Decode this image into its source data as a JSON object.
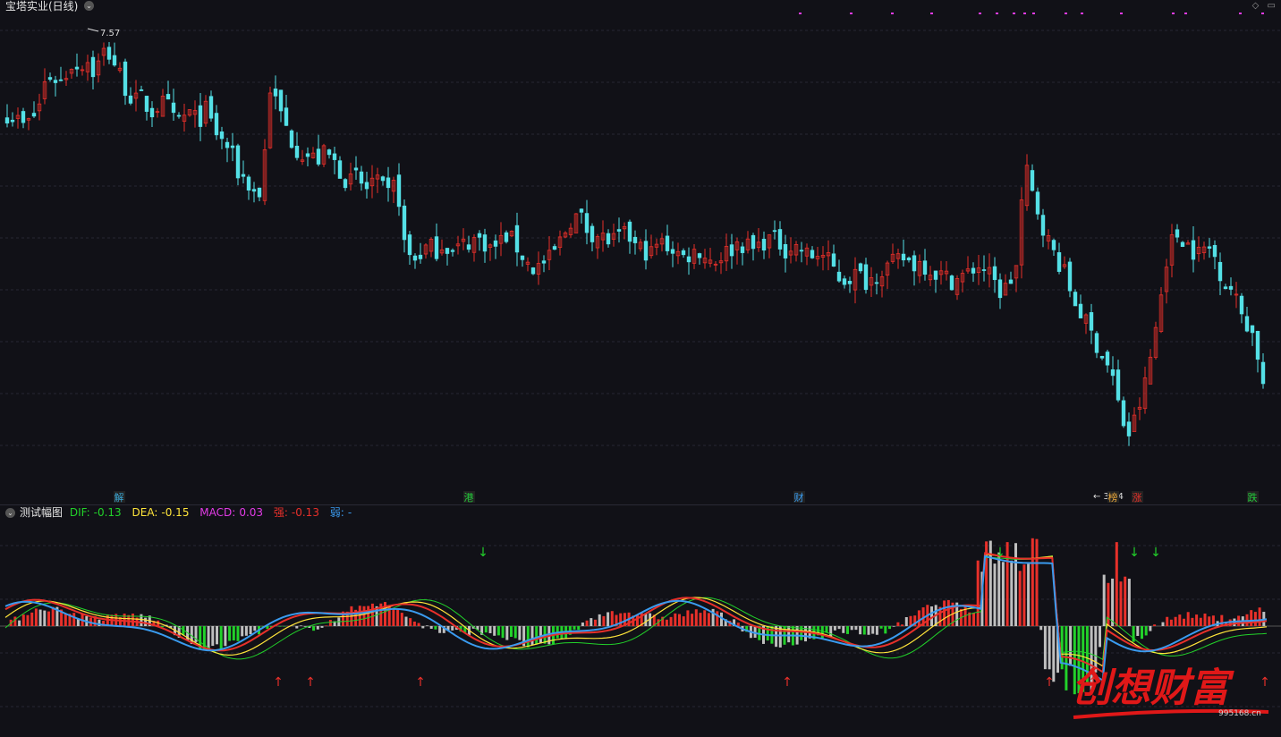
{
  "window": {
    "title": "宝塔实业(日线)"
  },
  "indicator": {
    "name": "测试幅图",
    "dif_label": "DIF:",
    "dif_value": "-0.13",
    "dea_label": "DEA:",
    "dea_value": "-0.15",
    "macd_label": "MACD:",
    "macd_value": "0.03",
    "strong_label": "强:",
    "strong_value": "-0.13",
    "weak_label": "弱:",
    "weak_value": "-"
  },
  "icons": {
    "collapse": "chevron-down-icon",
    "diamond": "diamond-icon",
    "menu": "menu-icon"
  },
  "colors": {
    "up": "#e8302a",
    "down": "#54e0e6",
    "dif": "#f0f0f0",
    "dea": "#ffe43a",
    "green": "#22d12a",
    "blue": "#3a9bef",
    "magenta": "#e23be6",
    "grey": "#bfbfbf"
  },
  "markers": {
    "high_label": "7.57",
    "low_label": "3.14",
    "events": [
      {
        "text": "解",
        "color": "#3aa6d6"
      },
      {
        "text": "港",
        "color": "#22c93a"
      },
      {
        "text": "财",
        "color": "#3a9bef"
      },
      {
        "text": "榜",
        "color": "#e8a53a"
      },
      {
        "text": "涨",
        "color": "#e8302a"
      },
      {
        "text": "跌",
        "color": "#22c93a"
      }
    ]
  },
  "watermark": {
    "text": "创想财富",
    "url": "995168.cn"
  },
  "chart_data": [
    {
      "type": "candlestick",
      "title": "宝塔实业(日线)",
      "annotations": [
        {
          "text": "7.57",
          "kind": "period-high"
        },
        {
          "text": "3.14",
          "kind": "period-low"
        }
      ],
      "close_path": [
        5.45,
        5.4,
        5.3,
        5.35,
        5.55,
        5.95,
        5.9,
        5.85,
        6.1,
        6.05,
        6.15,
        5.95,
        6.25,
        6.2,
        6.0,
        5.75,
        5.6,
        5.65,
        5.45,
        5.55,
        5.6,
        5.35,
        5.4,
        5.45,
        5.35,
        5.5,
        5.25,
        5.1,
        5.0,
        4.7,
        4.6,
        4.45,
        4.4,
        5.8,
        5.55,
        5.3,
        5.05,
        4.95,
        4.9,
        4.85,
        4.95,
        4.85,
        4.7,
        4.55,
        4.65,
        4.45,
        4.6,
        4.5,
        4.4,
        4.6,
        3.75,
        3.55,
        3.65,
        3.75,
        3.7,
        3.8,
        3.65,
        3.75,
        3.8,
        3.85,
        3.8,
        3.7,
        3.8,
        3.9,
        3.75,
        3.6,
        3.45,
        3.5,
        3.55,
        3.7,
        3.9,
        4.1,
        4.15,
        3.95,
        3.9,
        3.85,
        3.8,
        3.85,
        3.9,
        3.75,
        3.7,
        3.65,
        3.8,
        3.75,
        3.7,
        3.6,
        3.65,
        3.7,
        3.6,
        3.55,
        3.65,
        3.7,
        3.8,
        3.75,
        3.7,
        3.8,
        3.85,
        3.8,
        3.7,
        3.75,
        3.7,
        3.6,
        3.65,
        3.6,
        3.45,
        3.3,
        3.35,
        3.4,
        3.3,
        3.35,
        3.45,
        3.5,
        3.55,
        3.6,
        3.5,
        3.55,
        3.45,
        3.4,
        3.35,
        3.3,
        3.35,
        3.4,
        3.5,
        3.45,
        3.3,
        3.15,
        3.25,
        3.5,
        4.8,
        4.4,
        4.1,
        3.8,
        3.6,
        3.4,
        3.1,
        2.9,
        2.7,
        2.5,
        2.3,
        2.1,
        1.6,
        1.3,
        1.55,
        1.9,
        2.4,
        3.0,
        3.7,
        3.9,
        3.85,
        3.7,
        3.65,
        3.75,
        3.6,
        3.3,
        3.2,
        2.95,
        2.75,
        2.55,
        1.95
      ],
      "high": 7.57,
      "low": 3.14
    },
    {
      "type": "bar+line",
      "title": "测试幅图",
      "series": [
        {
          "name": "DIF",
          "last": -0.13
        },
        {
          "name": "DEA",
          "last": -0.15
        },
        {
          "name": "MACD",
          "last": 0.03
        },
        {
          "name": "强",
          "last": -0.13
        }
      ]
    }
  ]
}
